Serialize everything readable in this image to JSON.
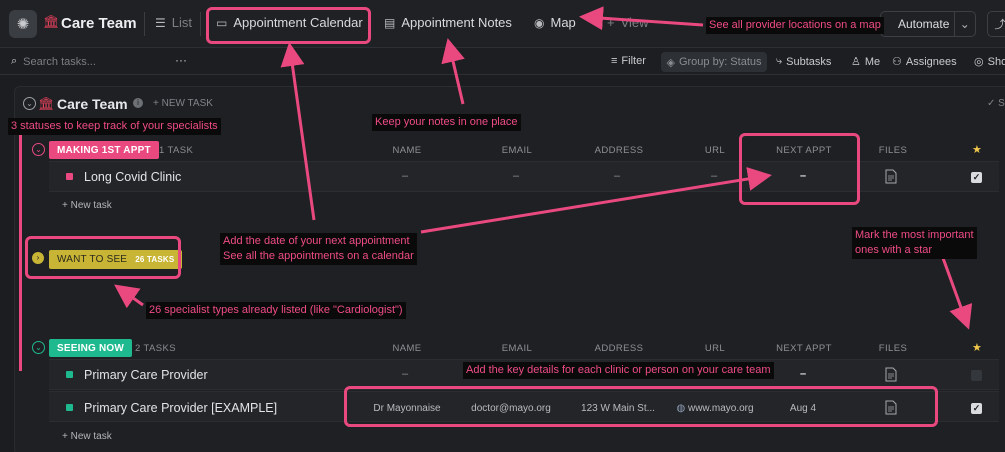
{
  "topbar": {
    "workspace_title": "Care Team",
    "tabs": [
      {
        "label": "List"
      },
      {
        "label": "Appointment Calendar"
      },
      {
        "label": "Appointment Notes"
      },
      {
        "label": "Map"
      },
      {
        "label": "View"
      }
    ],
    "automate_label": "Automate"
  },
  "toolbar": {
    "search_placeholder": "Search tasks...",
    "more": "···",
    "filter": "Filter",
    "group_by": "Group by: Status",
    "subtasks": "Subtasks",
    "me": "Me",
    "assignees": "Assignees",
    "show": "Show"
  },
  "list": {
    "title": "Care Team",
    "new_task_header": "+ NEW TASK",
    "new_task_row": "+ New task",
    "columns": [
      "NAME",
      "EMAIL",
      "ADDRESS",
      "URL",
      "NEXT APPT",
      "FILES"
    ],
    "groups": [
      {
        "status": "MAKING 1ST APPT",
        "count": "1 TASK",
        "color": "#e9497f",
        "rows": [
          {
            "name": "Long Covid Clinic",
            "name_col": "–",
            "email": "–",
            "address": "–",
            "url": "–",
            "next_appt": "–",
            "starred": true
          }
        ]
      },
      {
        "status": "WANT TO SEE",
        "count": "26 TASKS",
        "color": "#c9b535",
        "rows": []
      },
      {
        "status": "SEEING NOW",
        "count": "2 TASKS",
        "color": "#1fb98f",
        "rows": [
          {
            "name": "Primary Care Provider",
            "name_col": "–",
            "email": "–",
            "address": "–",
            "url": "–",
            "next_appt": "–",
            "starred": false
          },
          {
            "name": "Primary Care Provider [EXAMPLE]",
            "name_col": "Dr Mayonnaise",
            "email": "doctor@mayo.org",
            "address": "123 W Main St...",
            "url": "www.mayo.org",
            "next_appt": "Aug 4",
            "starred": true
          }
        ]
      }
    ]
  },
  "annotations": {
    "map": "See all provider locations on a map",
    "notes": "Keep your notes in one place",
    "statuses": "3 statuses to keep track of your specialists",
    "appt_line1": "Add the date of your next appointment",
    "appt_line2": "See all the appointments on a calendar",
    "star_line1": "Mark the most important",
    "star_line2": "ones with a star",
    "specialists": "26 specialist types already listed (like \"Cardiologist\")",
    "details": "Add the key details for each clinic or person on your care team"
  },
  "colors": {
    "accent": "#e9497f",
    "status_making": "#e9497f",
    "status_want": "#c9b535",
    "status_seeing": "#1fb98f"
  }
}
